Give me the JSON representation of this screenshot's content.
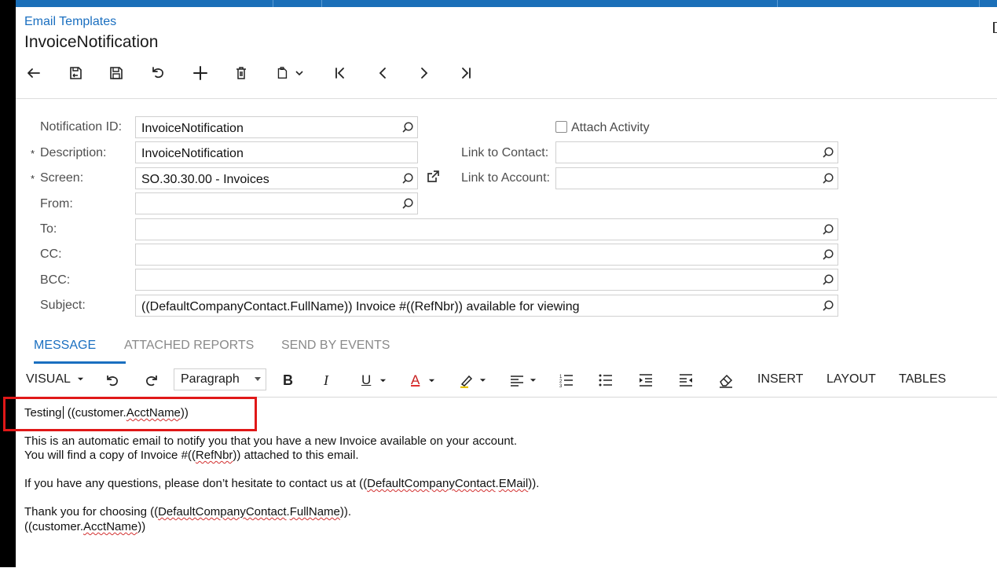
{
  "window": {
    "breadcrumb": "Email Templates",
    "title": "InvoiceNotification"
  },
  "toolbar": {
    "buttons": [
      "back-icon",
      "save-revert-icon",
      "save-icon",
      "undo-icon",
      "add-icon",
      "delete-icon",
      "copy-paste-icon",
      "first-record-icon",
      "previous-record-icon",
      "next-record-icon",
      "last-record-icon"
    ]
  },
  "form": {
    "notification_id_label": "Notification ID:",
    "notification_id_value": "InvoiceNotification",
    "description_label": "Description:",
    "description_value": "InvoiceNotification",
    "screen_label": "Screen:",
    "screen_value": "SO.30.30.00 - Invoices",
    "from_label": "From:",
    "from_value": "",
    "to_label": "To:",
    "to_value": "",
    "cc_label": "CC:",
    "cc_value": "",
    "bcc_label": "BCC:",
    "bcc_value": "",
    "subject_label": "Subject:",
    "subject_value": "((DefaultCompanyContact.FullName)) Invoice #((RefNbr)) available for viewing",
    "attach_activity_label": "Attach Activity",
    "attach_activity_checked": false,
    "link_to_contact_label": "Link to Contact:",
    "link_to_contact_value": "",
    "link_to_account_label": "Link to Account:",
    "link_to_account_value": "",
    "required_marker": "*"
  },
  "tabs": {
    "message": "MESSAGE",
    "attached_reports": "ATTACHED REPORTS",
    "send_by_events": "SEND BY EVENTS",
    "active": "MESSAGE"
  },
  "editor_toolbar": {
    "visual": "VISUAL",
    "paragraph": "Paragraph",
    "bold": "B",
    "italic": "I",
    "underline": "U",
    "font_color": "A",
    "insert": "INSERT",
    "layout": "LAYOUT",
    "tables": "TABLES"
  },
  "message": {
    "line1_prefix": "Testing",
    "line1_open": " ((customer.",
    "line1_field": "AcctName",
    "line1_close": "))",
    "line2": "This is an automatic email to notify you that you have a new Invoice available on your account.",
    "line3_prefix": "You will find a copy of Invoice #((",
    "line3_field": "RefNbr",
    "line3_suffix": ")) attached to this email.",
    "line4_prefix": "If you have any questions, please don’t hesitate to contact us at ((",
    "line4_field1": "DefaultCompanyContact",
    "line4_dot": ".",
    "line4_field2": "EMail",
    "line4_suffix": ")).",
    "line5_prefix": "Thank you for choosing ((",
    "line5_field1": "DefaultCompanyContact",
    "line5_dot": ".",
    "line5_field2": "FullName",
    "line5_suffix": ")).",
    "line6_prefix": "((customer.",
    "line6_field": "AcctName",
    "line6_suffix": "))"
  },
  "colors": {
    "accent": "#1a6fc0",
    "topbar": "#1b6fb8",
    "highlight_box": "#e01818"
  }
}
